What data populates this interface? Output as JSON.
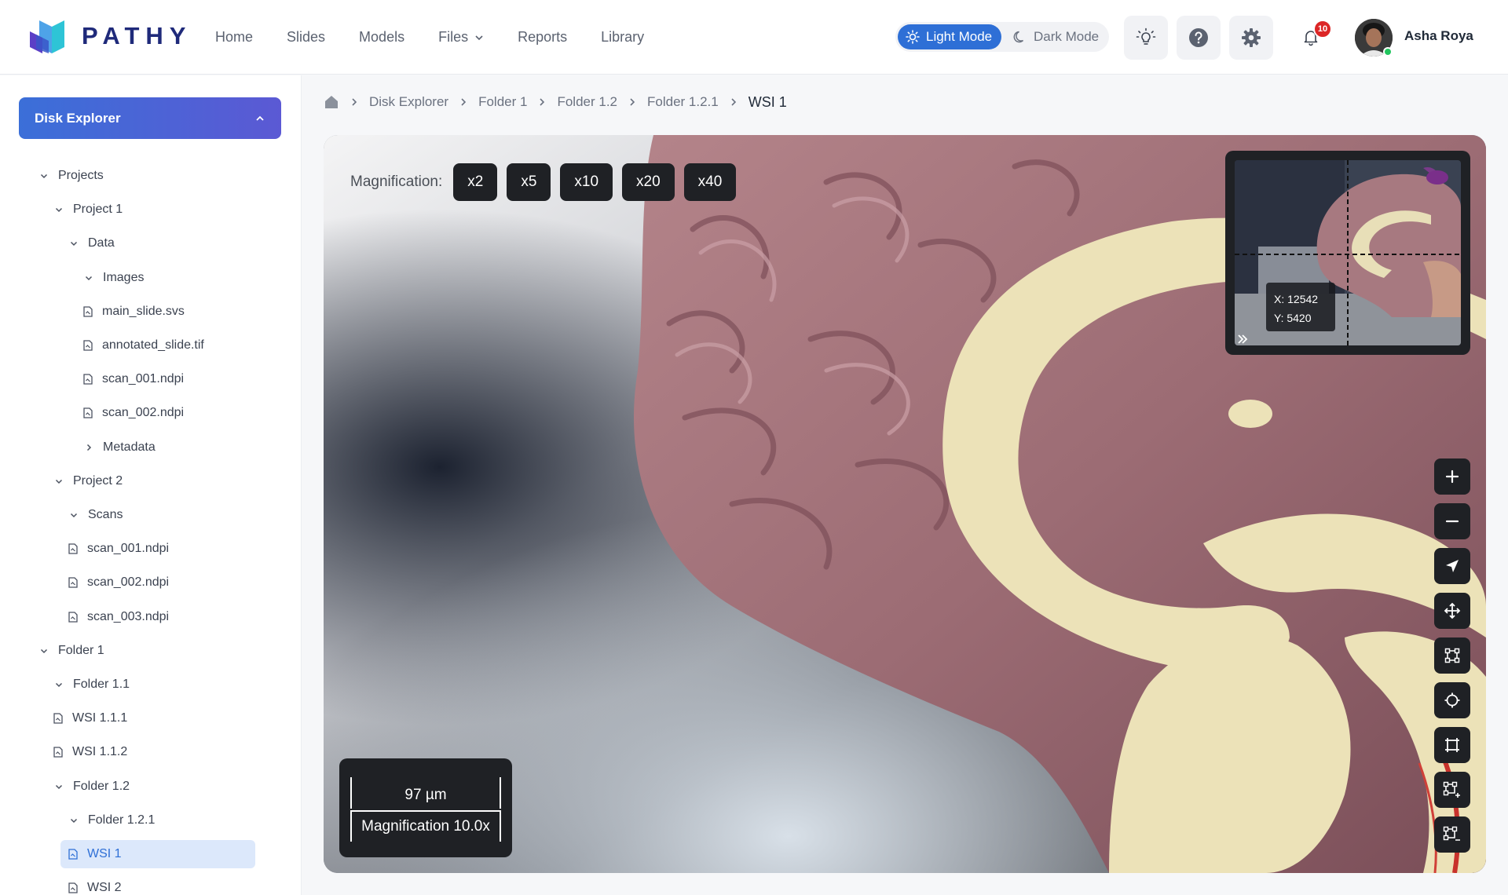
{
  "brand": {
    "name": "PATHY"
  },
  "nav": [
    {
      "label": "Home"
    },
    {
      "label": "Slides"
    },
    {
      "label": "Models"
    },
    {
      "label": "Files",
      "has_dropdown": true
    },
    {
      "label": "Reports"
    },
    {
      "label": "Library"
    }
  ],
  "mode": {
    "light_label": "Light Mode",
    "dark_label": "Dark Mode",
    "active": "light"
  },
  "header_icons": [
    "lightbulb-icon",
    "help-icon",
    "gear-icon"
  ],
  "notifications": {
    "count": "10"
  },
  "user": {
    "name": "Asha Roya",
    "status": "online"
  },
  "sidebar": {
    "title": "Disk Explorer",
    "tree": [
      {
        "label": "Projects",
        "type": "folder",
        "expanded": true,
        "depth": 0
      },
      {
        "label": "Project 1",
        "type": "folder",
        "expanded": true,
        "depth": 1
      },
      {
        "label": "Data",
        "type": "folder",
        "expanded": true,
        "depth": 2
      },
      {
        "label": "Images",
        "type": "folder",
        "expanded": true,
        "depth": 3
      },
      {
        "label": "main_slide.svs",
        "type": "file",
        "depth": 4
      },
      {
        "label": "annotated_slide.tif",
        "type": "file",
        "depth": 4
      },
      {
        "label": "scan_001.ndpi",
        "type": "file",
        "depth": 4
      },
      {
        "label": "scan_002.ndpi",
        "type": "file",
        "depth": 4
      },
      {
        "label": "Metadata",
        "type": "folder",
        "expanded": false,
        "depth": 3
      },
      {
        "label": "Project 2",
        "type": "folder",
        "expanded": true,
        "depth": 1
      },
      {
        "label": "Scans",
        "type": "folder",
        "expanded": true,
        "depth": 2
      },
      {
        "label": "scan_001.ndpi",
        "type": "file",
        "depth": 3
      },
      {
        "label": "scan_002.ndpi",
        "type": "file",
        "depth": 3
      },
      {
        "label": "scan_003.ndpi",
        "type": "file",
        "depth": 3
      },
      {
        "label": "Folder 1",
        "type": "folder",
        "expanded": true,
        "depth": 0
      },
      {
        "label": "Folder 1.1",
        "type": "folder",
        "expanded": true,
        "depth": 1
      },
      {
        "label": "WSI 1.1.1",
        "type": "file",
        "depth": 2
      },
      {
        "label": "WSI 1.1.2",
        "type": "file",
        "depth": 2
      },
      {
        "label": "Folder 1.2",
        "type": "folder",
        "expanded": true,
        "depth": 1
      },
      {
        "label": "Folder 1.2.1",
        "type": "folder",
        "expanded": true,
        "depth": 2
      },
      {
        "label": "WSI 1",
        "type": "file",
        "depth": 3,
        "active": true
      },
      {
        "label": "WSI 2",
        "type": "file",
        "depth": 3
      }
    ]
  },
  "breadcrumb": [
    "Disk Explorer",
    "Folder 1",
    "Folder 1.2",
    "Folder 1.2.1",
    "WSI 1"
  ],
  "viewer": {
    "magnification_label": "Magnification:",
    "magnifications": [
      "x2",
      "x5",
      "x10",
      "x20",
      "x40"
    ],
    "minimap": {
      "x": "X: 12542",
      "y": "Y: 5420"
    },
    "tools": [
      "zoom-in-icon",
      "zoom-out-icon",
      "navigate-icon",
      "pan-icon",
      "polygon-icon",
      "point-icon",
      "rectangle-icon",
      "add-region-icon",
      "remove-region-icon"
    ],
    "scale": {
      "value": "97 µm",
      "magnification": "Magnification 10.0x"
    }
  },
  "colors": {
    "accent": "#2e6fd6",
    "brand": "#1f2a7a",
    "badge": "#dc2626",
    "tool_bg": "#1f2125"
  }
}
